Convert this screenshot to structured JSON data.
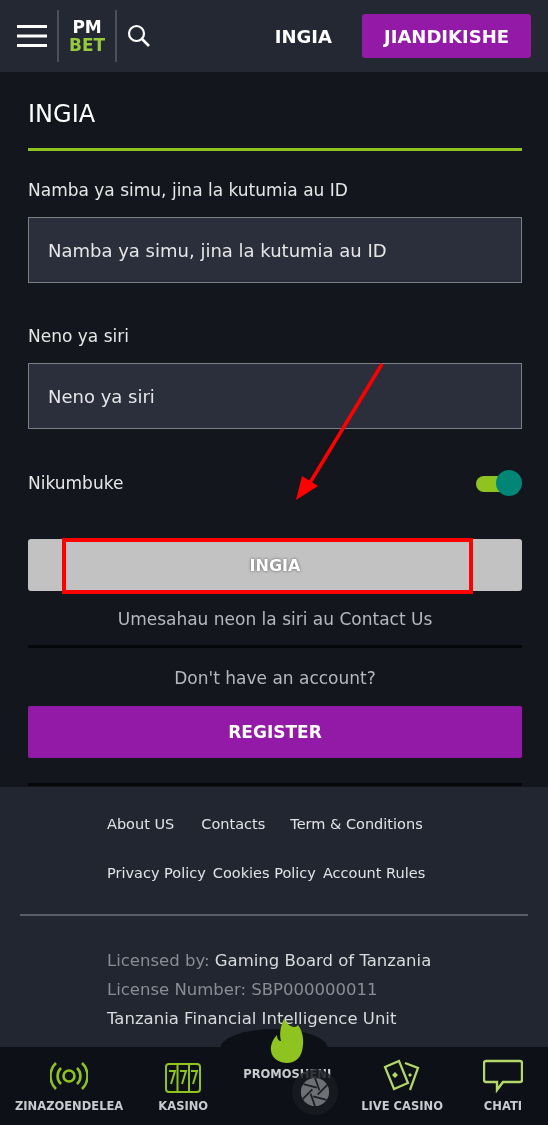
{
  "header": {
    "logo_top": "PM",
    "logo_bottom": "BET",
    "login_link": "INGIA",
    "register_button": "JIANDIKISHE"
  },
  "login": {
    "title": "INGIA",
    "fields": [
      {
        "label": "Namba ya simu, jina la kutumia au ID",
        "placeholder": "Namba ya simu, jina la kutumia au ID"
      },
      {
        "label": "Neno ya siri",
        "placeholder": "Neno ya siri"
      }
    ],
    "remember": {
      "label": "Nikumbuke",
      "on": true
    },
    "submit": "INGIA",
    "forgot": "Umesahau neon la siri au Contact Us",
    "no_account": "Don't have an account?",
    "register": "REGISTER"
  },
  "footer": {
    "links": [
      [
        "About US",
        "Contacts",
        "Term & Conditions"
      ],
      [
        "Privacy Policy",
        "Cookies Policy",
        "Account Rules"
      ]
    ],
    "license": [
      {
        "label": "Licensed by:",
        "value": "Gaming Board of Tanzania"
      },
      {
        "label": "License Number: SBP000000011"
      },
      {
        "value": "Tanzania Financial Intelligence Unit"
      }
    ]
  },
  "bottom_nav": [
    {
      "kind": "live",
      "label": "ZINAZOENDELEA"
    },
    {
      "kind": "slots",
      "label": "KASINO"
    },
    {
      "kind": "fire",
      "label": "PROMOSHENI"
    },
    {
      "kind": "cards",
      "label": "LIVE CASINO"
    },
    {
      "kind": "chat",
      "label": "CHATI"
    }
  ]
}
